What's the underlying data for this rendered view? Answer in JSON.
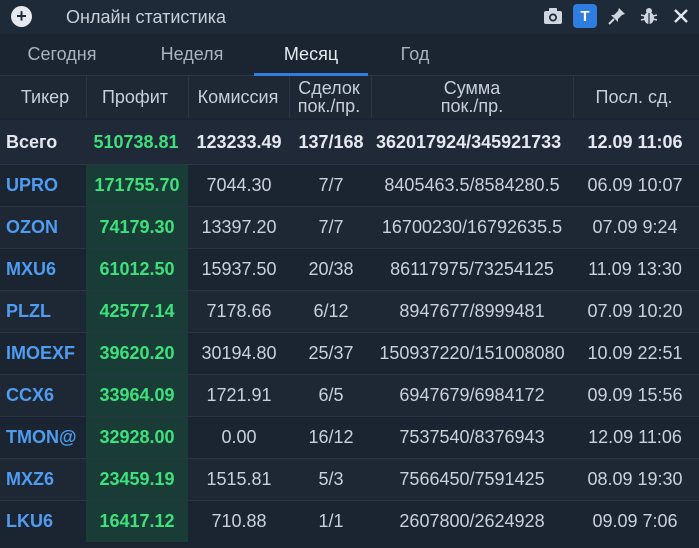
{
  "app": {
    "title": "Онлайн статистика",
    "t_label": "T"
  },
  "icons": {
    "add": "plus-circle-icon",
    "camera": "camera-icon",
    "pin": "pin-icon",
    "bug": "bug-icon",
    "close": "close-icon"
  },
  "tabs": [
    {
      "label": "Сегодня"
    },
    {
      "label": "Неделя"
    },
    {
      "label": "Месяц"
    },
    {
      "label": "Год"
    }
  ],
  "active_tab": "Месяц",
  "table": {
    "columns": {
      "ticker": "Тикер",
      "profit": "Профит",
      "commission": "Комиссия",
      "deals_line1": "Сделок",
      "deals_line2": "пок./пр.",
      "sum_line1": "Сумма",
      "sum_line2": "пок./пр.",
      "last": "Посл. сд."
    },
    "total": {
      "ticker": "Всего",
      "profit": "510738.81",
      "commission": "123233.49",
      "deals": "137/168",
      "sum": "362017924/345921733",
      "last": "12.09 11:06"
    },
    "rows": [
      {
        "ticker": "UPRO",
        "profit": "171755.70",
        "commission": "7044.30",
        "deals": "7/7",
        "sum": "8405463.5/8584280.5",
        "last": "06.09 10:07"
      },
      {
        "ticker": "OZON",
        "profit": "74179.30",
        "commission": "13397.20",
        "deals": "7/7",
        "sum": "16700230/16792635.5",
        "last": "07.09 9:24"
      },
      {
        "ticker": "MXU6",
        "profit": "61012.50",
        "commission": "15937.50",
        "deals": "20/38",
        "sum": "86117975/73254125",
        "last": "11.09 13:30"
      },
      {
        "ticker": "PLZL",
        "profit": "42577.14",
        "commission": "7178.66",
        "deals": "6/12",
        "sum": "8947677/8999481",
        "last": "07.09 10:20"
      },
      {
        "ticker": "IMOEXF",
        "profit": "39620.20",
        "commission": "30194.80",
        "deals": "25/37",
        "sum": "150937220/151008080",
        "last": "10.09 22:51"
      },
      {
        "ticker": "CCX6",
        "profit": "33964.09",
        "commission": "1721.91",
        "deals": "6/5",
        "sum": "6947679/6984172",
        "last": "09.09 15:56"
      },
      {
        "ticker": "TMON@",
        "profit": "32928.00",
        "commission": "0.00",
        "deals": "16/12",
        "sum": "7537540/8376943",
        "last": "12.09 11:06"
      },
      {
        "ticker": "MXZ6",
        "profit": "23459.19",
        "commission": "1515.81",
        "deals": "5/3",
        "sum": "7566450/7591425",
        "last": "08.09 19:30"
      },
      {
        "ticker": "LKU6",
        "profit": "16417.12",
        "commission": "710.88",
        "deals": "1/1",
        "sum": "2607800/2624928",
        "last": "09.09 7:06"
      }
    ]
  }
}
